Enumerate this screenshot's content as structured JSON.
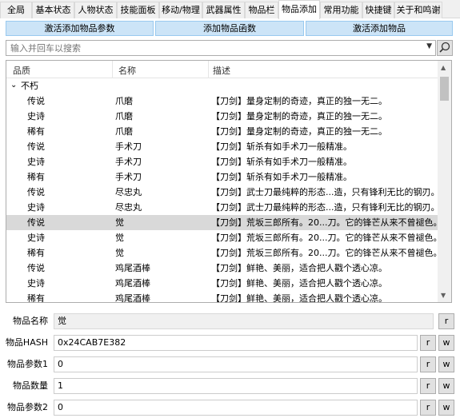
{
  "tabs": [
    "全局",
    "基本状态",
    "人物状态",
    "技能面板",
    "移动/物理",
    "武器属性",
    "物品栏",
    "物品添加",
    "常用功能",
    "快捷键",
    "关于和鸣谢"
  ],
  "active_tab": "物品添加",
  "actions": {
    "activate_params": "激活添加物品参数",
    "add_function": "添加物品函数",
    "activate_add": "激活添加物品"
  },
  "search": {
    "placeholder": "输入并回车以搜索"
  },
  "icons": {
    "search": "search-icon",
    "dropdown": "chevron-down-icon",
    "expand": "chevron-down-icon"
  },
  "list": {
    "columns": [
      "品质",
      "名称",
      "描述"
    ],
    "group": "不朽",
    "rows": [
      {
        "quality": "传说",
        "name": "爪磨",
        "desc": "【刀剑】量身定制的奇迹，真正的独一无二。"
      },
      {
        "quality": "史诗",
        "name": "爪磨",
        "desc": "【刀剑】量身定制的奇迹，真正的独一无二。"
      },
      {
        "quality": "稀有",
        "name": "爪磨",
        "desc": "【刀剑】量身定制的奇迹，真正的独一无二。"
      },
      {
        "quality": "传说",
        "name": "手术刀",
        "desc": "【刀剑】斩杀有如手术刀一般精准。"
      },
      {
        "quality": "史诗",
        "name": "手术刀",
        "desc": "【刀剑】斩杀有如手术刀一般精准。"
      },
      {
        "quality": "稀有",
        "name": "手术刀",
        "desc": "【刀剑】斩杀有如手术刀一般精准。"
      },
      {
        "quality": "传说",
        "name": "尽忠丸",
        "desc": "【刀剑】武士刀最纯粹的形态...造，只有锋利无比的钢刃。"
      },
      {
        "quality": "史诗",
        "name": "尽忠丸",
        "desc": "【刀剑】武士刀最纯粹的形态...造，只有锋利无比的钢刃。"
      },
      {
        "quality": "传说",
        "name": "觉",
        "desc": "【刀剑】荒坂三郎所有。20...刀。它的锋芒从来不曾褪色。"
      },
      {
        "quality": "史诗",
        "name": "觉",
        "desc": "【刀剑】荒坂三郎所有。20...刀。它的锋芒从来不曾褪色。"
      },
      {
        "quality": "稀有",
        "name": "觉",
        "desc": "【刀剑】荒坂三郎所有。20...刀。它的锋芒从来不曾褪色。"
      },
      {
        "quality": "传说",
        "name": "鸡尾酒棒",
        "desc": "【刀剑】鲜艳、美丽，适合把人戳个透心凉。"
      },
      {
        "quality": "史诗",
        "name": "鸡尾酒棒",
        "desc": "【刀剑】鲜艳、美丽，适合把人戳个透心凉。"
      },
      {
        "quality": "稀有",
        "name": "鸡尾酒棒",
        "desc": "【刀剑】鲜艳、美丽，适合把人戳个透心凉。"
      }
    ],
    "selected_row": 8
  },
  "form": {
    "item_name": {
      "label": "物品名称",
      "value": "觉"
    },
    "item_hash": {
      "label": "物品HASH",
      "value": "0x24CAB7E382"
    },
    "param1": {
      "label": "物品参数1",
      "value": "0"
    },
    "count": {
      "label": "物品数量",
      "value": "1"
    },
    "param2": {
      "label": "物品参数2",
      "value": "0"
    },
    "read_label": "r",
    "write_label": "w"
  }
}
